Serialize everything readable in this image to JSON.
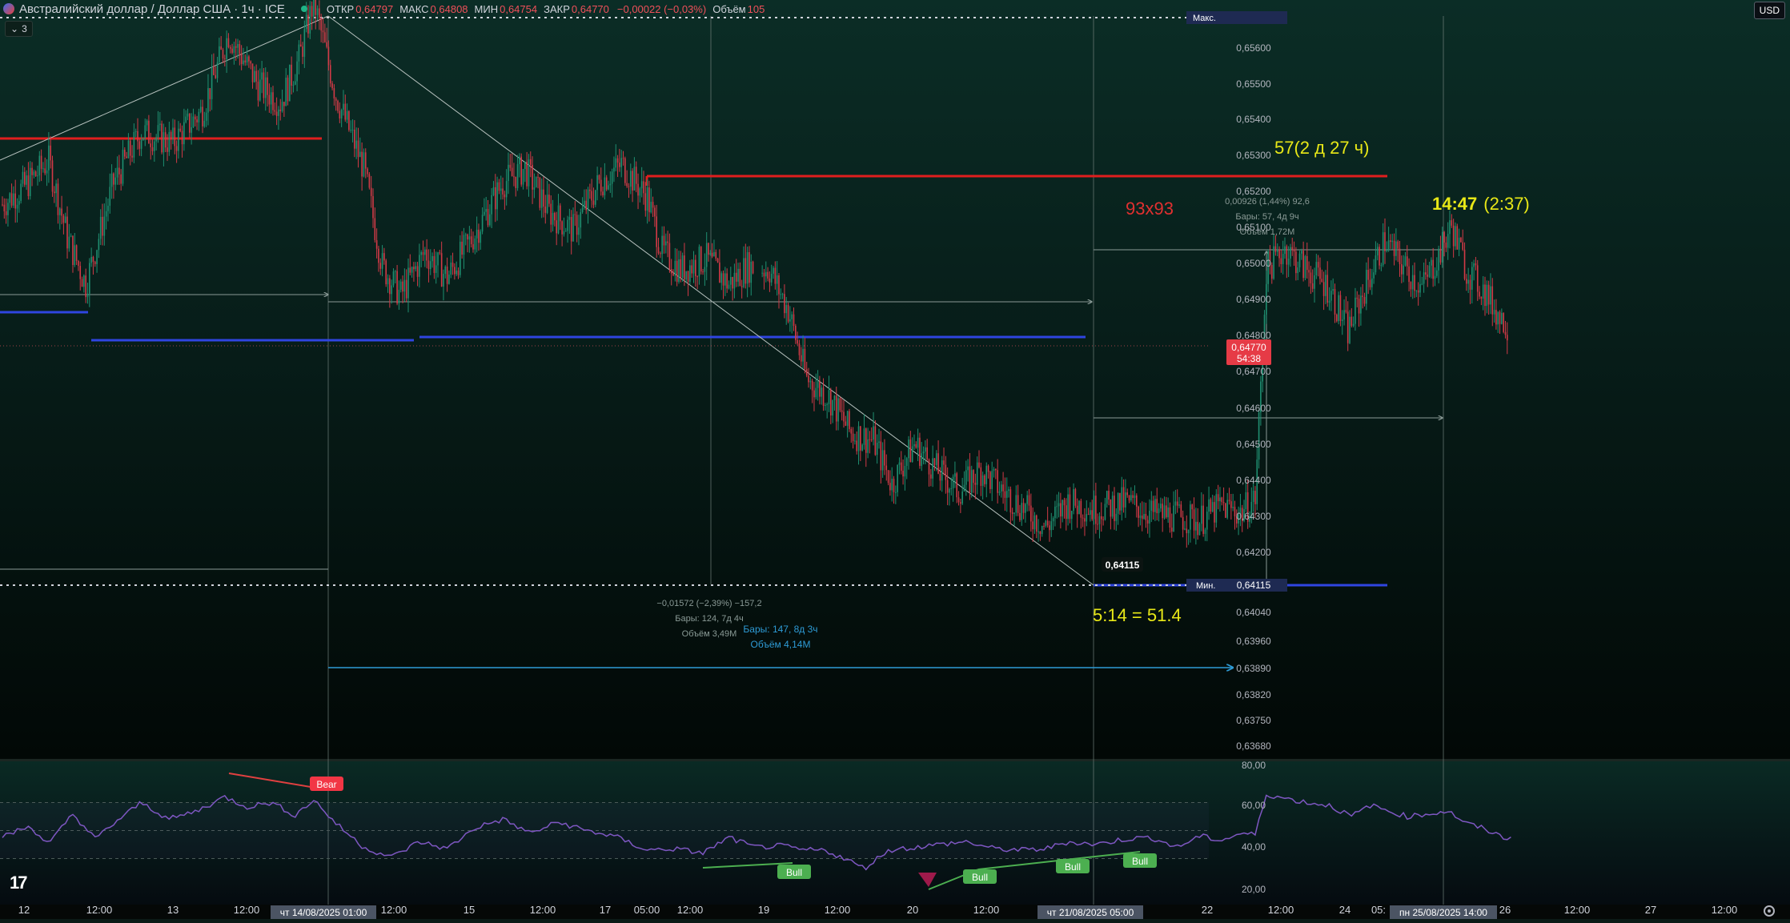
{
  "header": {
    "symbol_title": "Австралийский доллар / Доллар США · 1ч · ICE",
    "ohlc": [
      {
        "key": "ОТКР",
        "value": "0,64797"
      },
      {
        "key": "МАКС",
        "value": "0,64808"
      },
      {
        "key": "МИН",
        "value": "0,64754"
      },
      {
        "key": "ЗАКР",
        "value": "0,64770"
      },
      {
        "key": "",
        "value": "−0,00022 (−0,03%)"
      },
      {
        "key": "Объём",
        "value": "105"
      }
    ],
    "indicators_count": "3",
    "currency": "USD"
  },
  "chart_data": [
    {
      "type": "candlestick",
      "title": "Австралийский доллар / Доллар США · 1ч · ICE",
      "ylim": [
        0.6361,
        0.6571
      ],
      "y_ticks": [
        "0,65600",
        "0,65500",
        "0,65400",
        "0,65300",
        "0,65200",
        "0,65100",
        "0,65000",
        "0,64900",
        "0,64800",
        "0,64700",
        "0,64600",
        "0,64500",
        "0,64400",
        "0,64300",
        "0,64200",
        "0,64040",
        "0,63960",
        "0,63890",
        "0,63820",
        "0,63750",
        "0,63680"
      ],
      "x_ticks": [
        "12",
        "12:00",
        "13",
        "12:00",
        "12:00",
        "15",
        "12:00",
        "17",
        "05:00",
        "12:00",
        "19",
        "12:00",
        "20",
        "12:00",
        "22",
        "12:00",
        "24",
        "05:",
        "26",
        "12:00",
        "27",
        "12:00"
      ],
      "x_badges": [
        "чт 14/08/2025   01:00",
        "чт 21/08/2025   05:00",
        "пн 25/08/2025   14:00"
      ],
      "price_marks": {
        "max_label": "Макс.",
        "min_label": "Мин.",
        "min_value": "0,64115",
        "current_price": "0,64770",
        "countdown": "54:38"
      },
      "annotations": {
        "count_label": "57(2 д 27 ч)",
        "ratio_label": "93x93",
        "time_bold": "14:47",
        "time_plain": "(2:37)",
        "ratio_bottom": "5:14 = 51.4",
        "low_marker": "0,64115",
        "range_right": [
          "0,00926 (1,44%) 92,6",
          "Бары: 57, 4д 9ч",
          "Объём 1,72M"
        ],
        "range_mid": [
          "−0,01572 (−2,39%) −157,2",
          "Бары: 124, 7д 4ч",
          "Объём 3,49M"
        ],
        "range_blue": [
          "Бары: 147, 8д 3ч",
          "Объём 4,14M"
        ]
      },
      "series": [
        {
          "name": "AUDUSD 1h",
          "anchors": [
            [
              0,
              0.651
            ],
            [
              12,
              0.6515
            ],
            [
              25,
              0.6522
            ],
            [
              35,
              0.6501
            ],
            [
              45,
              0.6488
            ],
            [
              60,
              0.6516
            ],
            [
              75,
              0.653
            ],
            [
              92,
              0.6527
            ],
            [
              108,
              0.6536
            ],
            [
              122,
              0.6557
            ],
            [
              138,
              0.6543
            ],
            [
              150,
              0.6538
            ],
            [
              160,
              0.655
            ],
            [
              168,
              0.6566
            ],
            [
              180,
              0.654
            ],
            [
              195,
              0.652
            ],
            [
              205,
              0.6493
            ],
            [
              215,
              0.6485
            ],
            [
              228,
              0.6497
            ],
            [
              240,
              0.649
            ],
            [
              255,
              0.6502
            ],
            [
              270,
              0.6516
            ],
            [
              282,
              0.652
            ],
            [
              295,
              0.6508
            ],
            [
              308,
              0.6503
            ],
            [
              322,
              0.6516
            ],
            [
              334,
              0.6521
            ],
            [
              348,
              0.6512
            ],
            [
              356,
              0.6497
            ],
            [
              366,
              0.6492
            ],
            [
              380,
              0.6495
            ],
            [
              392,
              0.6488
            ],
            [
              402,
              0.6493
            ],
            [
              414,
              0.6492
            ],
            [
              424,
              0.6481
            ],
            [
              434,
              0.6462
            ],
            [
              446,
              0.6457
            ],
            [
              458,
              0.6447
            ],
            [
              470,
              0.6445
            ],
            [
              480,
              0.6433
            ],
            [
              492,
              0.6444
            ],
            [
              504,
              0.6437
            ],
            [
              516,
              0.6431
            ],
            [
              528,
              0.6437
            ],
            [
              540,
              0.6431
            ],
            [
              552,
              0.6426
            ],
            [
              563,
              0.6421
            ],
            [
              575,
              0.6428
            ],
            [
              590,
              0.6426
            ],
            [
              606,
              0.6428
            ],
            [
              620,
              0.6425
            ],
            [
              634,
              0.6424
            ],
            [
              646,
              0.6423
            ],
            [
              658,
              0.6427
            ],
            [
              668,
              0.6425
            ],
            [
              676,
              0.6429
            ],
            [
              682,
              0.6492
            ],
            [
              692,
              0.6498
            ],
            [
              704,
              0.6492
            ],
            [
              716,
              0.6487
            ],
            [
              726,
              0.6475
            ],
            [
              736,
              0.6488
            ],
            [
              746,
              0.65
            ],
            [
              756,
              0.6493
            ],
            [
              766,
              0.6487
            ],
            [
              776,
              0.6497
            ],
            [
              782,
              0.6504
            ],
            [
              790,
              0.6492
            ],
            [
              800,
              0.6486
            ],
            [
              808,
              0.6479
            ],
            [
              812,
              0.6477
            ]
          ]
        }
      ]
    },
    {
      "type": "line",
      "title": "",
      "ylim": [
        17,
        83
      ],
      "y_ticks": [
        "80,00",
        "60,00",
        "40,00",
        "20,00"
      ],
      "levels": [
        70,
        50,
        30
      ],
      "signals": [
        {
          "label": "Bear",
          "color": "#f23645"
        },
        {
          "label": "Bull",
          "color": "#4caf50"
        },
        {
          "label": "Bull",
          "color": "#4caf50"
        },
        {
          "label": "Bull",
          "color": "#4caf50"
        },
        {
          "label": "Bull",
          "color": "#4caf50"
        }
      ],
      "series": [
        {
          "name": "RSI",
          "anchors": [
            [
              0,
              46
            ],
            [
              15,
              53
            ],
            [
              25,
              40
            ],
            [
              38,
              62
            ],
            [
              50,
              44
            ],
            [
              62,
              57
            ],
            [
              75,
              70
            ],
            [
              90,
              58
            ],
            [
              105,
              64
            ],
            [
              120,
              74
            ],
            [
              132,
              67
            ],
            [
              145,
              70
            ],
            [
              158,
              61
            ],
            [
              168,
              72
            ],
            [
              180,
              55
            ],
            [
              195,
              38
            ],
            [
              210,
              31
            ],
            [
              225,
              42
            ],
            [
              240,
              37
            ],
            [
              255,
              52
            ],
            [
              270,
              58
            ],
            [
              285,
              48
            ],
            [
              300,
              56
            ],
            [
              315,
              50
            ],
            [
              330,
              46
            ],
            [
              348,
              36
            ],
            [
              362,
              37
            ],
            [
              378,
              34
            ],
            [
              392,
              45
            ],
            [
              406,
              38
            ],
            [
              420,
              39
            ],
            [
              432,
              36
            ],
            [
              444,
              36
            ],
            [
              456,
              29
            ],
            [
              465,
              23
            ],
            [
              478,
              36
            ],
            [
              492,
              38
            ],
            [
              505,
              40
            ],
            [
              520,
              42
            ],
            [
              535,
              37
            ],
            [
              550,
              36
            ],
            [
              563,
              37
            ],
            [
              575,
              42
            ],
            [
              590,
              40
            ],
            [
              606,
              44
            ],
            [
              620,
              45
            ],
            [
              634,
              38
            ],
            [
              646,
              46
            ],
            [
              658,
              43
            ],
            [
              668,
              48
            ],
            [
              676,
              47
            ],
            [
              682,
              76
            ],
            [
              692,
              73
            ],
            [
              704,
              70
            ],
            [
              716,
              68
            ],
            [
              728,
              60
            ],
            [
              738,
              68
            ],
            [
              748,
              64
            ],
            [
              758,
              60
            ],
            [
              770,
              62
            ],
            [
              780,
              64
            ],
            [
              790,
              55
            ],
            [
              800,
              51
            ],
            [
              810,
              45
            ],
            [
              815,
              45
            ]
          ]
        }
      ]
    }
  ]
}
